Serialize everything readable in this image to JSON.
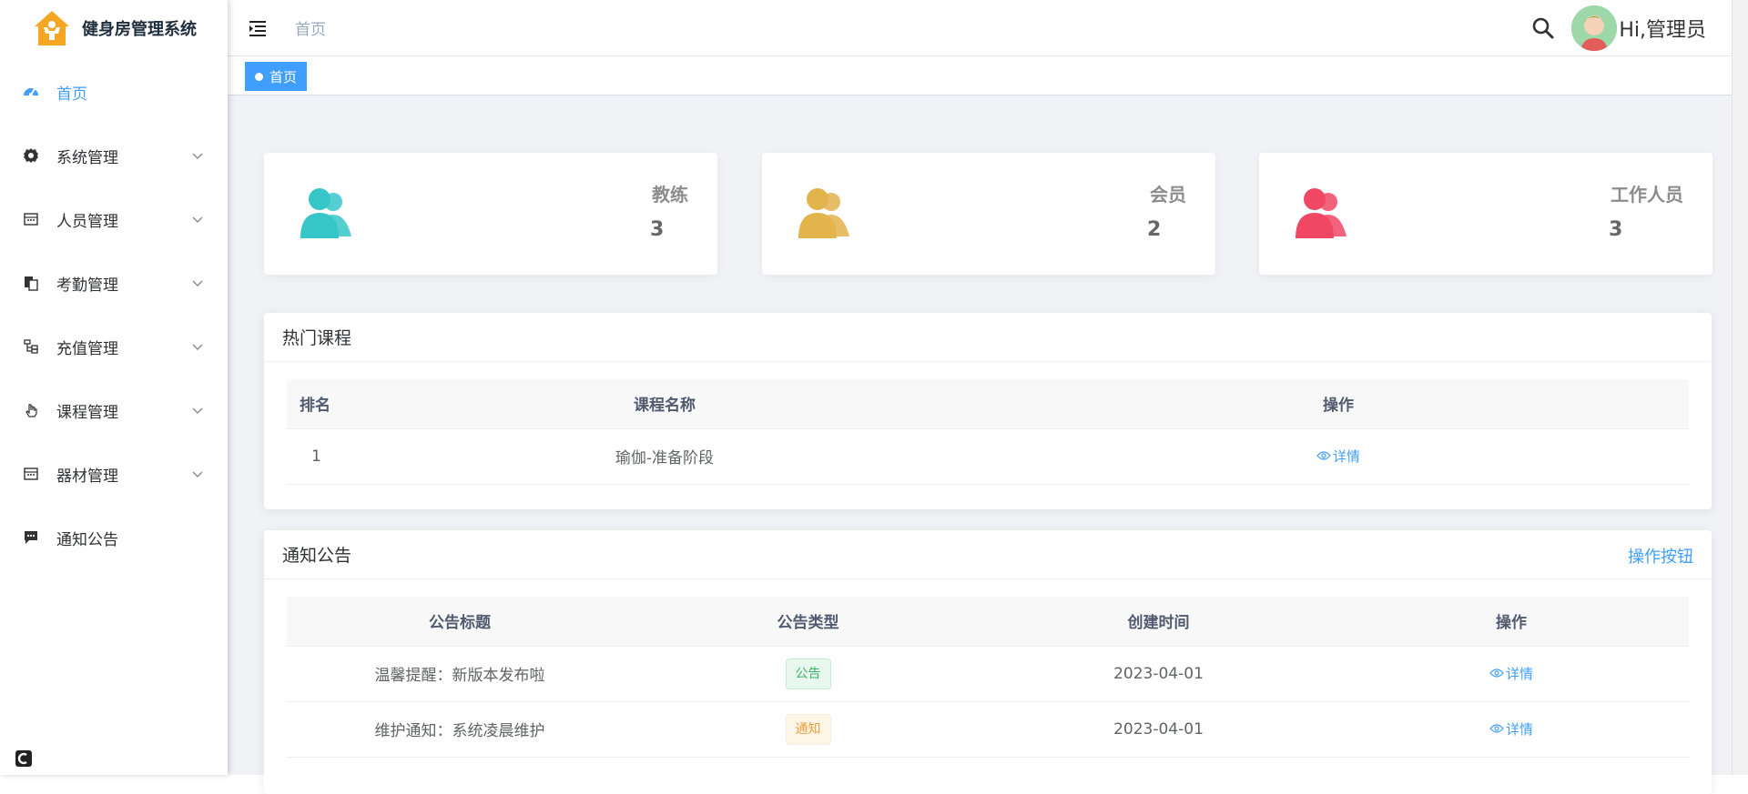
{
  "app": {
    "title": "健身房管理系统"
  },
  "sidebar": {
    "items": [
      {
        "label": "首页",
        "icon": "dashboard-icon",
        "active": true
      },
      {
        "label": "系统管理",
        "icon": "gear-icon"
      },
      {
        "label": "人员管理",
        "icon": "calendar-icon"
      },
      {
        "label": "考勤管理",
        "icon": "documents-icon"
      },
      {
        "label": "充值管理",
        "icon": "tree-icon"
      },
      {
        "label": "课程管理",
        "icon": "hand-icon"
      },
      {
        "label": "器材管理",
        "icon": "calendar-icon"
      },
      {
        "label": "通知公告",
        "icon": "chat-icon"
      }
    ]
  },
  "header": {
    "breadcrumb": "首页",
    "greeting": "Hi,管理员"
  },
  "tags": {
    "active_label": "首页"
  },
  "stats": [
    {
      "label": "教练",
      "value": "3",
      "color": "#36c6c8"
    },
    {
      "label": "会员",
      "value": "2",
      "color": "#e3b34c"
    },
    {
      "label": "工作人员",
      "value": "3",
      "color": "#f04864"
    }
  ],
  "hot_courses": {
    "title": "热门课程",
    "columns": [
      "排名",
      "课程名称",
      "操作"
    ],
    "rows": [
      {
        "rank": "1",
        "name": "瑜伽-准备阶段",
        "action": "详情"
      }
    ]
  },
  "notices": {
    "title": "通知公告",
    "action_label": "操作按钮",
    "columns": [
      "公告标题",
      "公告类型",
      "创建时间",
      "操作"
    ],
    "rows": [
      {
        "title": "温馨提醒：新版本发布啦",
        "type": "公告",
        "type_color": "green",
        "date": "2023-04-01",
        "action": "详情"
      },
      {
        "title": "维护通知：系统凌晨维护",
        "type": "通知",
        "type_color": "orange",
        "date": "2023-04-01",
        "action": "详情"
      }
    ]
  },
  "colors": {
    "accent": "#409eff"
  }
}
